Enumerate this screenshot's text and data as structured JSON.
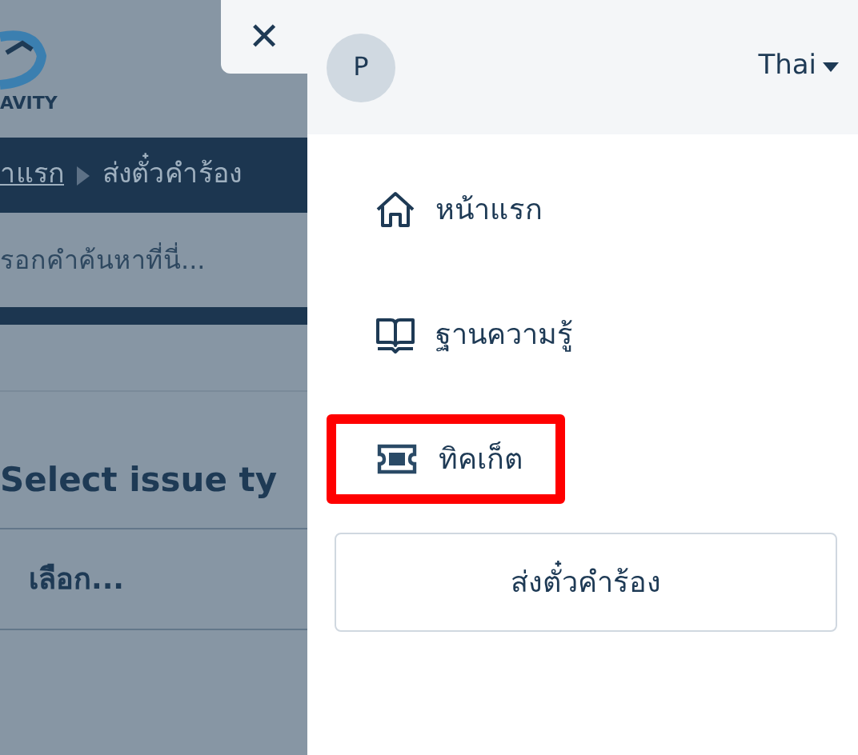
{
  "background": {
    "logo_text": "AVITY",
    "breadcrumb": [
      {
        "label": "าแรก",
        "link": true
      },
      {
        "label": "ส่งตั๋วคำร้อง",
        "link": false
      }
    ],
    "search": {
      "placeholder": "รอกคำค้นหาที่นี่..."
    },
    "heading": "Select issue ty",
    "select": {
      "value": "เลือก..."
    }
  },
  "drawer": {
    "close": "✕",
    "avatar": "P",
    "language": "Thai",
    "nav": [
      {
        "kind": "home",
        "label": "หน้าแรก",
        "selected": false
      },
      {
        "kind": "book",
        "label": "ฐานความรู้",
        "selected": false
      },
      {
        "kind": "ticket",
        "label": "ทิคเก็ต",
        "selected": true
      }
    ],
    "button": "ส่งตั๋วคำร้อง"
  }
}
